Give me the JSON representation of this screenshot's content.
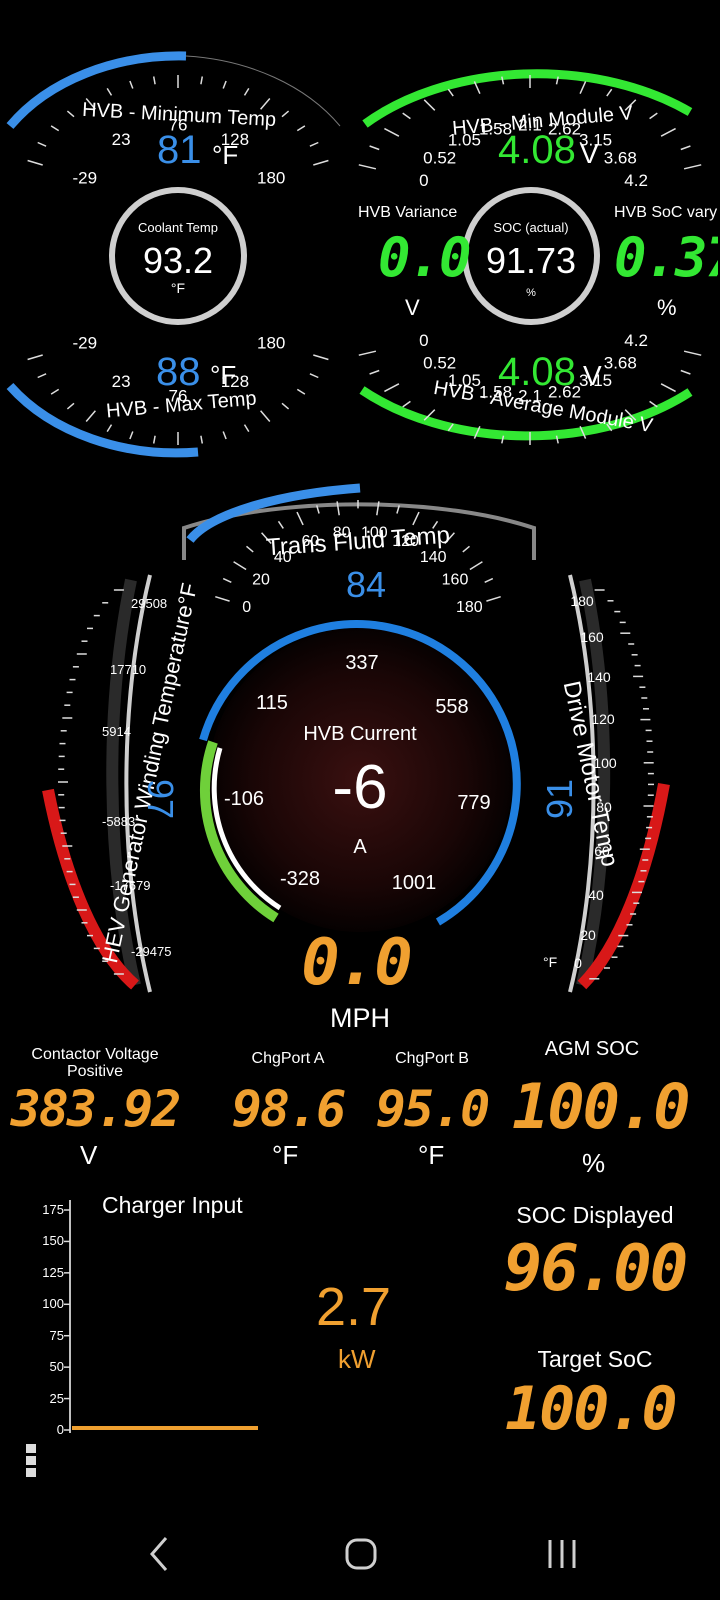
{
  "gauges": {
    "min_temp": {
      "label": "HVB - Minimum Temp",
      "value": "81",
      "unit": "°F",
      "ticks": [
        "-29",
        "23",
        "76",
        "128",
        "180"
      ],
      "range": [
        -29,
        180
      ],
      "level": 81
    },
    "min_module_v": {
      "label": "HVB - Min Module V",
      "value": "4.08",
      "unit": "V",
      "ticks": [
        "0",
        "0.52",
        "1.05",
        "1.58",
        "2.1",
        "2.62",
        "3.15",
        "3.68",
        "4.2"
      ],
      "range": [
        0,
        4.2
      ],
      "level": 4.08
    },
    "max_temp": {
      "label": "HVB - Max Temp",
      "value": "88",
      "unit": "°F",
      "ticks": [
        "-29",
        "23",
        "76",
        "128",
        "180"
      ],
      "range": [
        -29,
        180
      ],
      "level": 88
    },
    "avg_module_v": {
      "label": "HVB - Average Module V",
      "value": "4.08",
      "unit": "V",
      "ticks": [
        "0",
        "0.52",
        "1.05",
        "1.58",
        "2.1",
        "2.62",
        "3.15",
        "3.68",
        "4.2"
      ],
      "range": [
        0,
        4.2
      ],
      "level": 4.08
    },
    "coolant": {
      "label": "Coolant Temp",
      "value": "93.2",
      "unit": "°F"
    },
    "soc_actual": {
      "label": "SOC (actual)",
      "value": "91.73",
      "unit": "%"
    },
    "trans_fluid": {
      "label": "Trans Fluid Temp",
      "value": "84",
      "ticks": [
        "0",
        "20",
        "40",
        "60",
        "80",
        "100",
        "120",
        "140",
        "160",
        "180"
      ],
      "range": [
        0,
        180
      ],
      "level": 84
    },
    "generator": {
      "label": "HEV Generator Winding Temperature°F",
      "value": "97",
      "ticks": [
        "29508",
        "17710",
        "5914",
        "-5883",
        "-17679",
        "-29475"
      ]
    },
    "drive_motor": {
      "label": "Drive Motor Temp",
      "value": "91",
      "unit": "°F",
      "ticks": [
        "180",
        "160",
        "140",
        "120",
        "100",
        "80",
        "60",
        "40",
        "20",
        "0"
      ]
    },
    "hvb_current": {
      "label": "HVB Current",
      "value": "-6",
      "unit": "A",
      "ticks": [
        "-328",
        "-106",
        "115",
        "337",
        "558",
        "779",
        "1001"
      ]
    }
  },
  "readouts": {
    "hvb_variance": {
      "label": "HVB Variance",
      "value": "0.0",
      "unit": "V"
    },
    "hvb_soc_vary": {
      "label": "HVB SoC vary",
      "value": "0.37",
      "unit": "%"
    },
    "speed": {
      "value": "0.0",
      "unit": "MPH"
    },
    "contactor": {
      "label_line1": "Contactor Voltage",
      "label_line2": "Positive",
      "value": "383.92",
      "unit": "V"
    },
    "chgport_a": {
      "label": "ChgPort A",
      "value": "98.6",
      "unit": "°F"
    },
    "chgport_b": {
      "label": "ChgPort B",
      "value": "95.0",
      "unit": "°F"
    },
    "agm_soc": {
      "label": "AGM SOC",
      "value": "100.0",
      "unit": "%"
    },
    "soc_displayed": {
      "label": "SOC Displayed",
      "value": "96.00"
    },
    "target_soc": {
      "label": "Target SoC",
      "value": "100.0"
    }
  },
  "chart_data": {
    "type": "line",
    "title": "Charger Input",
    "ylim": [
      0,
      175
    ],
    "yticks": [
      "175",
      "150",
      "125",
      "100",
      "75",
      "50",
      "25",
      "0"
    ],
    "series": [
      {
        "values": [
          0,
          0
        ]
      }
    ],
    "current_value": "2.7",
    "unit": "kW"
  },
  "colors": {
    "blue": "#3a8fe8",
    "green": "#33e833",
    "orange": "#f0a030",
    "red": "#d81818"
  },
  "icons": {
    "menu": "drag-handle-icon",
    "back": "back-icon",
    "home": "home-icon",
    "recents": "recents-icon"
  }
}
